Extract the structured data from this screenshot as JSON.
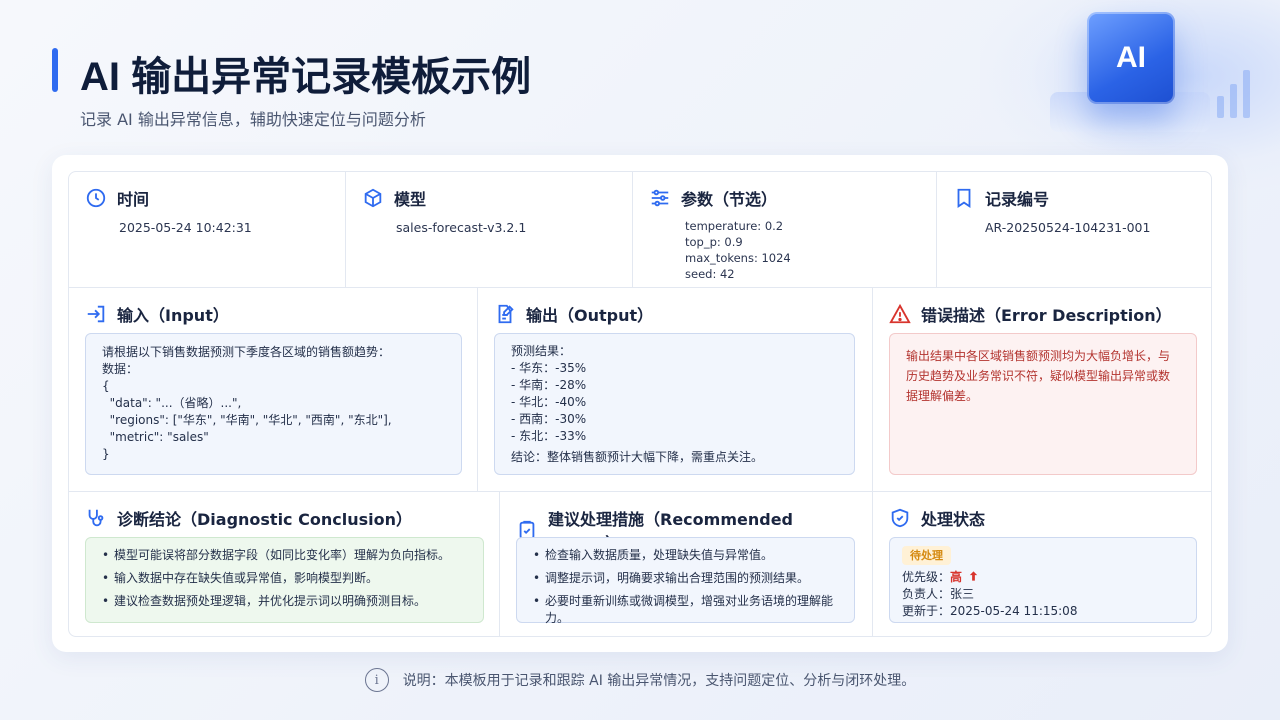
{
  "page": {
    "title": "AI 输出异常记录模板示例",
    "subtitle": "记录 AI 输出异常信息，辅助快速定位与问题分析",
    "deco_label": "AI"
  },
  "meta": {
    "time": {
      "label": "时间",
      "value": "2025-05-24 10:42:31"
    },
    "model": {
      "label": "模型",
      "value": "sales-forecast-v3.2.1"
    },
    "params": {
      "label": "参数（节选）",
      "lines": [
        "temperature: 0.2",
        "top_p: 0.9",
        "max_tokens: 1024",
        "seed: 42"
      ]
    },
    "record": {
      "label": "记录编号",
      "value": "AR-20250524-104231-001"
    }
  },
  "input": {
    "label": "输入（Input）",
    "lines": [
      "请根据以下销售数据预测下季度各区域的销售额趋势：",
      "数据：",
      "{",
      "  \"data\": \"...（省略）...\",",
      "  \"regions\": [\"华东\", \"华南\", \"华北\", \"西南\", \"东北\"],",
      "  \"metric\": \"sales\"",
      "}"
    ]
  },
  "output": {
    "label": "输出（Output）",
    "lines": [
      "预测结果：",
      "- 华东：-35%",
      "- 华南：-28%",
      "- 华北：-40%",
      "- 西南：-30%",
      "- 东北：-33%"
    ],
    "conclusion": "结论：整体销售额预计大幅下降，需重点关注。"
  },
  "error": {
    "label": "错误描述（Error Description）",
    "text": "输出结果中各区域销售额预测均为大幅负增长，与历史趋势及业务常识不符，疑似模型输出异常或数据理解偏差。"
  },
  "diagnosis": {
    "label": "诊断结论（Diagnostic Conclusion）",
    "items": [
      "模型可能误将部分数据字段（如同比变化率）理解为负向指标。",
      "输入数据中存在缺失值或异常值，影响模型判断。",
      "建议检查数据预处理逻辑，并优化提示词以明确预测目标。"
    ]
  },
  "action": {
    "label": "建议处理措施（Recommended Action）",
    "items": [
      "检查输入数据质量，处理缺失值与异常值。",
      "调整提示词，明确要求输出合理范围的预测结果。",
      "必要时重新训练或微调模型，增强对业务语境的理解能力。"
    ]
  },
  "status": {
    "label": "处理状态",
    "badge": "待处理",
    "priority_label": "优先级：",
    "priority_value": "高",
    "owner": "负责人：张三",
    "updated": "更新于：2025-05-24 11:15:08"
  },
  "footer": {
    "icon": "i",
    "text": "说明：本模板用于记录和跟踪 AI 输出异常情况，支持问题定位、分析与闭环处理。"
  },
  "colors": {
    "accent": "#2f6bf0",
    "danger": "#d8342d",
    "warning": "#d58a11"
  }
}
